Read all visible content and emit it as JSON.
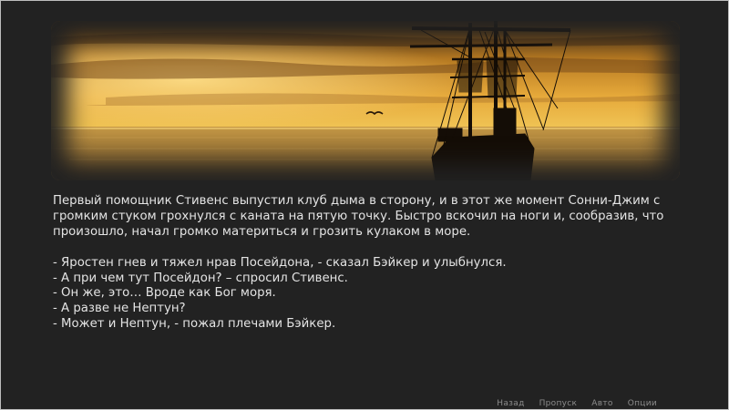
{
  "scene": {
    "image": "sunset-sea-sailing-ship",
    "colors": {
      "sky_top": "#3a2410",
      "sky_mid": "#c8861e",
      "sky_glow": "#f2c24a",
      "sea": "#8a6a3a",
      "ship": "#140d06"
    }
  },
  "narration": {
    "paragraph_lines": [
      "Первый помощник Стивенс выпустил клуб дыма в сторону, и в этот же момент Сонни-Джим с",
      "громким стуком грохнулся с каната на пятую точку. Быстро вскочил на ноги и, сообразив, что",
      "произошло, начал громко материться и грозить кулаком в море."
    ],
    "dialogue_lines": [
      "- Яростен гнев и тяжел нрав Посейдона, - сказал Бэйкер и улыбнулся.",
      "- А при чем тут Посейдон? – спросил Стивенс.",
      "- Он же, это… Вроде как Бог моря.",
      "- А разве не Нептун?",
      "- Может и Нептун, - пожал плечами Бэйкер."
    ]
  },
  "quick_menu": {
    "items": [
      "Назад",
      "Пропуск",
      "Авто",
      "Опции"
    ]
  }
}
